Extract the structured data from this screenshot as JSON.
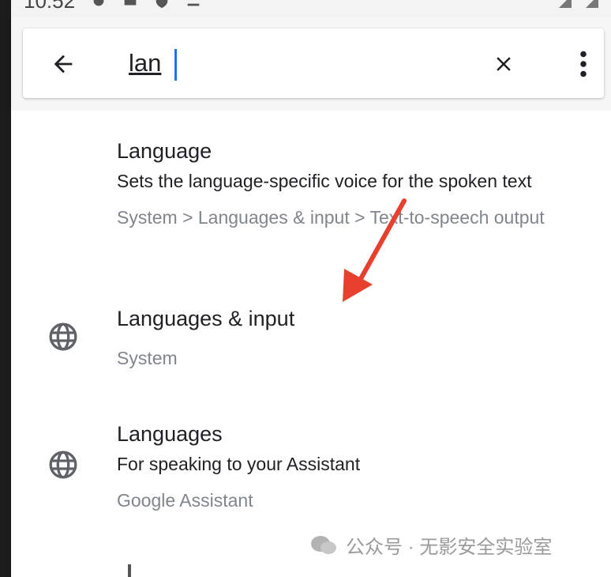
{
  "status": {
    "time": "10:52"
  },
  "search": {
    "query": "lan"
  },
  "results": [
    {
      "title": "Language",
      "summary": "Sets the language-specific voice for the spoken text",
      "path": "System > Languages & input > Text-to-speech output"
    },
    {
      "title": "Languages & input",
      "path": "System"
    },
    {
      "title": "Languages",
      "summary": "For speaking to your Assistant",
      "path": "Google Assistant"
    }
  ],
  "watermark": {
    "text": "公众号 · 无影安全实验室"
  },
  "colors": {
    "accent": "#1a73e8",
    "annotation_arrow": "#e8402e"
  }
}
